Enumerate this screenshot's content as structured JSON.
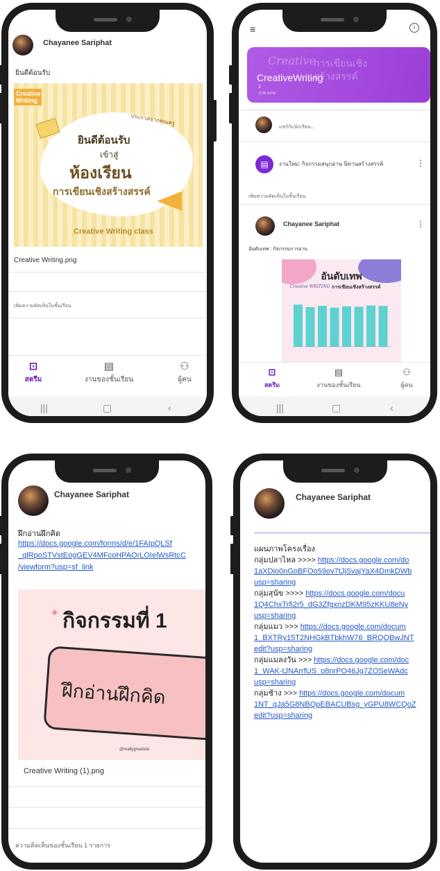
{
  "phone1": {
    "author": "Chayanee Sariphat",
    "post_text": "ยินดีต้อนรับ",
    "image": {
      "corner_tag": "Creative Writing",
      "ribbon": "ประกาศจากคุณครู",
      "line1": "ยินดีต้อนรับ",
      "line2": "เข้าสู่",
      "line3": "ห้องเรียน",
      "line4": "การเขียนเชิงสร้างสรรค์",
      "footer": "Creative Writing class"
    },
    "attachment": "Creative Writing.png",
    "comment_placeholder": "เพิ่มความคิดเห็นในชั้นเรียน"
  },
  "phone2": {
    "banner_script": "Creative",
    "banner_thai": "การเขียนเชิงสร้างสรรค์",
    "class_name": "CreativeWriting",
    "class_num": "1",
    "banner_tag": "JOIN NOW",
    "share_prompt": "แชร์กับนักเรียน...",
    "assignment": "งานใหม่: กิจกรรมสนุกอ่าน นิทานสร้างสรรค์",
    "add_comment": "เพิ่มความคิดเห็นในชั้นเรียน",
    "author": "Chayanee Sariphat",
    "post_text": "อันดับเทพ : กิจกรรมการอ่าน",
    "chart_title": "อันดับเทพ",
    "chart_script": "Creative WRITING",
    "chart_subtitle": "การเขียนเชิงสร้างสรรค์",
    "chart_bars": [
      0.98,
      0.92,
      0.95,
      0.91,
      0.94,
      0.93,
      0.96,
      0.95
    ]
  },
  "phone3": {
    "author": "Chayanee Sariphat",
    "post_title": "ฝึกอ่านฝึกคิด",
    "link_lines": [
      "https://docs.google.com/forms/d/e/1FAIpQLSf",
      "_qlRpoSTVstEogGEV4MFcoHPAOrLOIelWsRtcC",
      "/viewform?usp=sf_link"
    ],
    "image": {
      "title": "กิจกรรมที่ 1",
      "card_text": "ฝึกอ่านฝึกคิด",
      "credit": "@reallygreatsite"
    },
    "attachment": "Creative Writing (1).png",
    "comments": "ความคิดเห็นของชั้นเรียน 1 รายการ"
  },
  "phone4": {
    "author": "Chayanee Sariphat",
    "heading": "แผนภาพโครงเรื่อง",
    "groups": [
      {
        "label": "กลุ่มปลาไหล >>>> ",
        "lines": [
          "https://docs.google.com/do",
          "1aXDio0nGoBFOo59ov7tJjSvajYaX4DmkDWb",
          "usp=sharing"
        ]
      },
      {
        "label": "กลุ่มสุนัข >>>> ",
        "lines": [
          "https://docs.google.com/docu",
          "1Q4ChxTrfi2r5_dG3ZfgxnzDKM95zKKU8eNy",
          "usp=sharing"
        ]
      },
      {
        "label": "กลุ่มแมว >>> ",
        "lines": [
          "https://docs.google.com/docum",
          "1_BXTRy15T2NHGkBTbkhW76_BRQQBwJNT",
          "edit?usp=sharing"
        ]
      },
      {
        "label": "กลุ่มแมลงวัน >>> ",
        "lines": [
          "https://docs.google.com/doc",
          "1_WAK-tJNArrfUS_o8nrPO46Jg7ZOSeWAdc",
          "usp=sharing"
        ]
      },
      {
        "label": "กลุ่มช้าง >>> ",
        "lines": [
          "https://docs.google.com/docum",
          "1NT_qJa5G8NBQpEBACUBsg_yGPU8WCQoZ",
          "edit?usp=sharing"
        ]
      }
    ]
  },
  "nav": {
    "stream": "สตรีม",
    "classwork": "งานของชั้นเรียน",
    "people": "ผู้คน"
  },
  "colors": {
    "accent": "#6a1bbf",
    "banner": "#a64de0",
    "link": "#2358c6",
    "frame": "#1c1c1c",
    "poster_yellow": "#f7e3a1",
    "chart_bar": "#5ed2d0"
  }
}
